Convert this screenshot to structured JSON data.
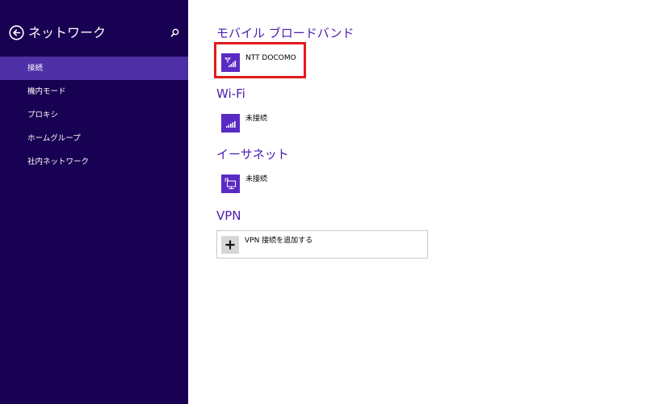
{
  "sidebar": {
    "title": "ネットワーク",
    "back_icon": "back-arrow-icon",
    "search_icon": "search-icon",
    "items": [
      {
        "label": "接続",
        "selected": true
      },
      {
        "label": "機内モード",
        "selected": false
      },
      {
        "label": "プロキシ",
        "selected": false
      },
      {
        "label": "ホームグループ",
        "selected": false
      },
      {
        "label": "社内ネットワーク",
        "selected": false
      }
    ]
  },
  "main": {
    "mobile_broadband": {
      "title": "モバイル ブロードバンド",
      "connection": {
        "label": "NTT DOCOMO",
        "icon": "mobile-signal-icon"
      }
    },
    "wifi": {
      "title": "Wi-Fi",
      "connection": {
        "label": "未接続",
        "icon": "wifi-signal-icon"
      }
    },
    "ethernet": {
      "title": "イーサネット",
      "connection": {
        "label": "未接続",
        "icon": "ethernet-icon"
      }
    },
    "vpn": {
      "title": "VPN",
      "add_label": "VPN 接続を追加する",
      "add_icon": "plus-icon"
    }
  },
  "colors": {
    "sidebar_bg": "#180052",
    "sidebar_selected": "#4d2fa6",
    "accent": "#4b1cb0",
    "tile": "#5a2bc4",
    "highlight": "#e31a1c"
  }
}
